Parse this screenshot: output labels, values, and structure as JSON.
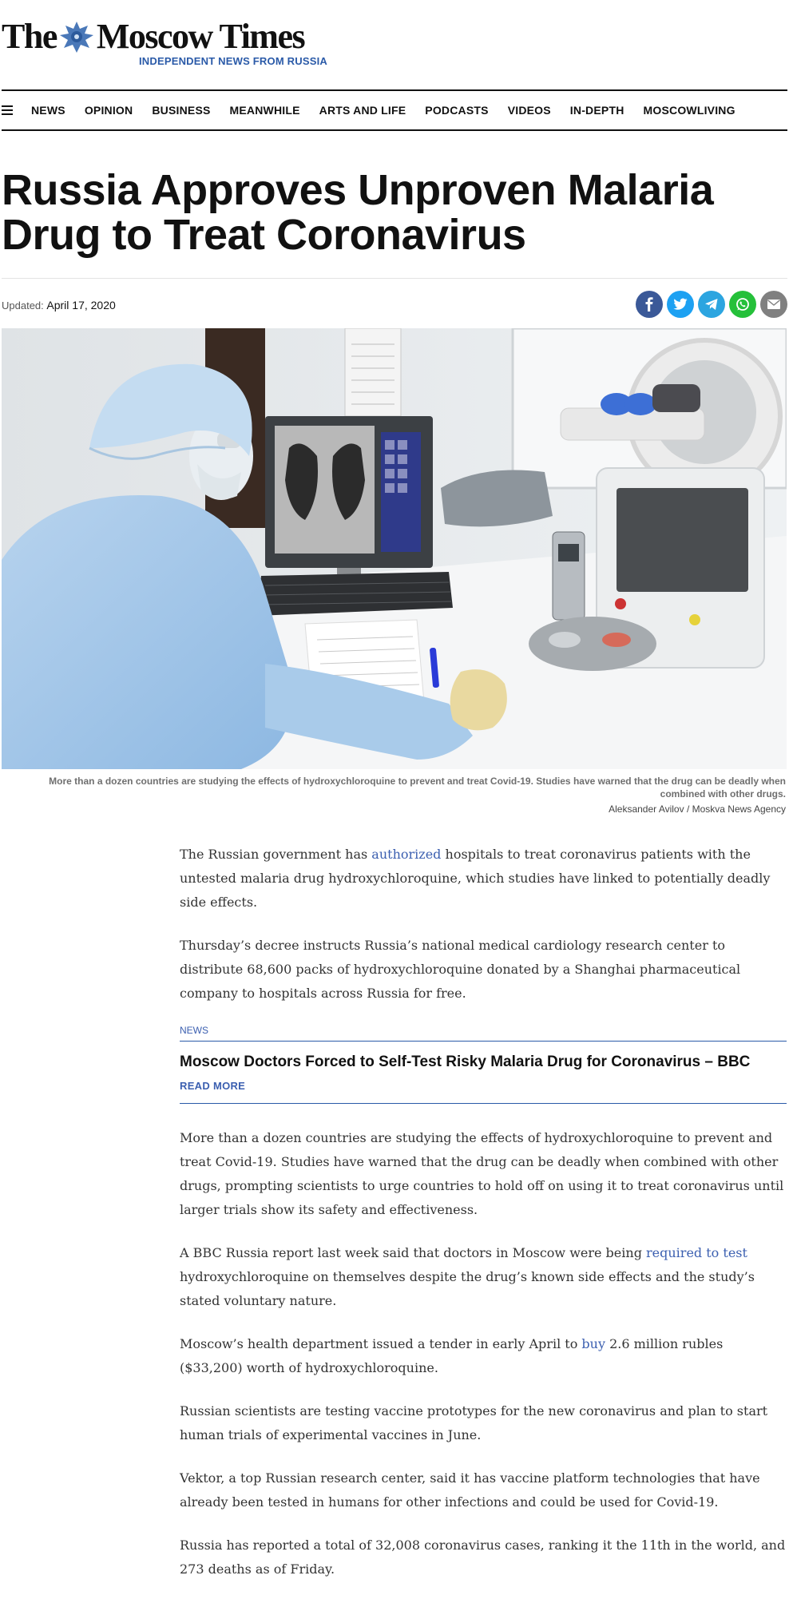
{
  "site": {
    "logo_left": "The",
    "logo_right": "Moscow Times",
    "tagline": "INDEPENDENT NEWS FROM RUSSIA"
  },
  "nav": {
    "items": [
      "NEWS",
      "OPINION",
      "BUSINESS",
      "MEANWHILE",
      "ARTS AND LIFE",
      "PODCASTS",
      "VIDEOS",
      "IN-DEPTH",
      "MOSCOWLIVING"
    ]
  },
  "article": {
    "headline": "Russia Approves Unproven Malaria Drug to Treat Coronavirus",
    "updated_label": "Updated:",
    "updated_date": "April 17, 2020",
    "caption": "More than a dozen countries are studying the effects of hydroxychloroquine to prevent and treat Covid-19. Studies have warned that the drug can be deadly when combined with other drugs.",
    "credit": "Aleksander Avilov / Moskva News Agency",
    "p1_a": "The Russian government has ",
    "p1_link": "authorized",
    "p1_b": " hospitals to treat coronavirus patients with the untested malaria drug hydroxychloroquine, which studies have linked to potentially deadly side effects.",
    "p2": "Thursday’s decree instructs Russia’s national medical cardiology research center to distribute 68,600 packs of hydroxychloroquine donated by a Shanghai pharmaceutical company to hospitals across Russia for free.",
    "related": {
      "category": "NEWS",
      "title": "Moscow Doctors Forced to Self-Test Risky Malaria Drug for Coronavirus – BBC",
      "read_more": "READ MORE"
    },
    "p3": "More than a dozen countries are studying the effects of hydroxychloroquine to prevent and treat Covid-19. Studies have warned that the drug can be deadly when combined with other drugs, prompting scientists to urge countries to hold off on using it to treat coronavirus until larger trials show its safety and effectiveness.",
    "p4_a": "A BBC Russia report last week said that doctors in Moscow were being ",
    "p4_link": "required to test",
    "p4_b": " hydroxychloroquine on themselves despite the drug’s known side effects and the study’s stated voluntary nature.",
    "p5_a": "Moscow’s health department issued a tender in early April to ",
    "p5_link": "buy",
    "p5_b": " 2.6 million rubles ($33,200) worth of hydroxychloroquine.",
    "p6": "Russian scientists are testing vaccine prototypes for the new coronavirus and plan to start human trials of experimental vaccines in June.",
    "p7": "Vektor, a top Russian research center, said it has vaccine platform technologies that have already been tested in humans for other infections and could be used for Covid-19.",
    "p8": "Russia has reported a total of 32,008 coronavirus cases, ranking it the 11th in the world, and 273 deaths as of Friday."
  },
  "share": [
    {
      "icon": "facebook-icon",
      "color": "#3b5998"
    },
    {
      "icon": "twitter-icon",
      "color": "#1da1f2"
    },
    {
      "icon": "telegram-icon",
      "color": "#2ca5e0"
    },
    {
      "icon": "whatsapp-icon",
      "color": "#25c03a"
    },
    {
      "icon": "email-icon",
      "color": "#808080"
    }
  ]
}
